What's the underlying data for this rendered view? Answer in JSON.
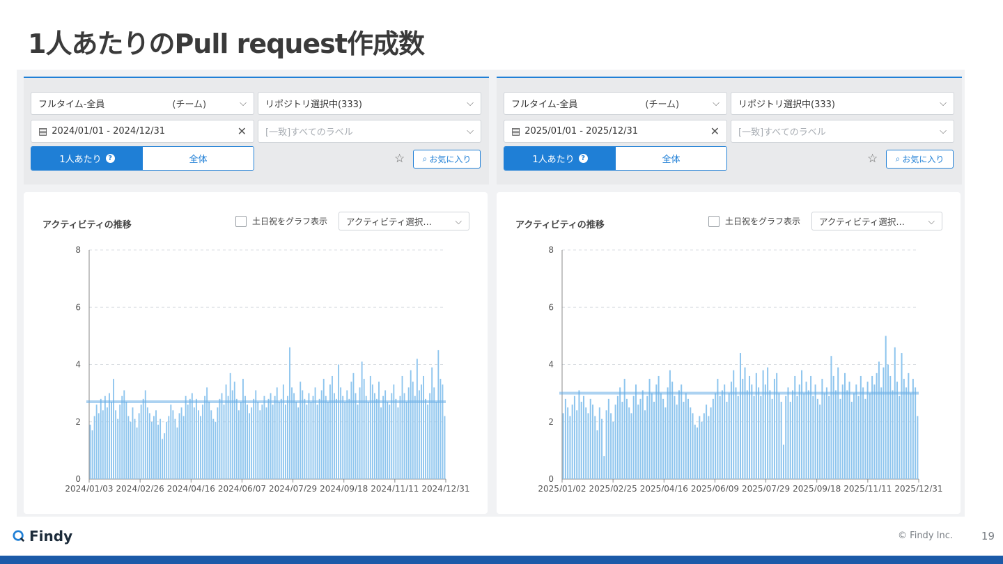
{
  "slide": {
    "title": "1人あたりのPull request作成数",
    "footer_brand": "Findy",
    "copyright": "© Findy Inc.",
    "page_number": "19"
  },
  "colors": {
    "accent": "#1f7fd6",
    "bar": "#8ec5ee",
    "avg_line": "#6aaee6",
    "footer_bar": "#1b5aa8"
  },
  "panels": [
    {
      "filters": {
        "member_select": "フルタイム-全員",
        "member_scope": "(チーム)",
        "repo_select": "リポジトリ選択中(333)",
        "date_range": "2024/01/01 - 2024/12/31",
        "label_placeholder": "[一致]すべてのラベル",
        "seg_per_person": "1人あたり",
        "seg_all": "全体",
        "favorite_label": "お気に入り"
      },
      "card": {
        "title": "アクティビティの推移",
        "weekend_checkbox": "土日祝をグラフ表示",
        "activity_select": "アクティビティ選択…"
      }
    },
    {
      "filters": {
        "member_select": "フルタイム-全員",
        "member_scope": "(チーム)",
        "repo_select": "リポジトリ選択中(333)",
        "date_range": "2025/01/01 - 2025/12/31",
        "label_placeholder": "[一致]すべてのラベル",
        "seg_per_person": "1人あたり",
        "seg_all": "全体",
        "favorite_label": "お気に入り"
      },
      "card": {
        "title": "アクティビティの推移",
        "weekend_checkbox": "土日祝をグラフ表示",
        "activity_select": "アクティビティ選択…"
      }
    }
  ],
  "chart_data": [
    {
      "type": "bar",
      "ylim": [
        0,
        8
      ],
      "yticks": [
        0,
        2,
        4,
        6,
        8
      ],
      "grid": "horizontal-dashed",
      "average": 2.7,
      "x_tick_labels": [
        "2024/01/03",
        "2024/02/26",
        "2024/04/16",
        "2024/06/07",
        "2024/07/29",
        "2024/09/18",
        "2024/11/11",
        "2024/12/31"
      ],
      "values": [
        1.9,
        1.7,
        2.2,
        2.6,
        2.3,
        2.8,
        2.4,
        2.9,
        2.5,
        3.0,
        2.7,
        3.5,
        2.4,
        2.1,
        2.6,
        2.9,
        3.1,
        2.7,
        2.2,
        2.0,
        2.5,
        2.1,
        1.8,
        2.3,
        2.6,
        2.8,
        3.1,
        2.5,
        2.3,
        2.0,
        2.2,
        2.4,
        1.9,
        2.1,
        1.4,
        1.6,
        2.0,
        2.2,
        2.6,
        2.4,
        2.1,
        1.8,
        2.3,
        2.5,
        2.2,
        2.9,
        2.6,
        2.8,
        3.0,
        2.5,
        2.8,
        2.4,
        2.2,
        2.6,
        2.9,
        3.2,
        2.7,
        2.4,
        2.1,
        2.0,
        2.5,
        2.8,
        3.0,
        2.6,
        3.3,
        2.9,
        3.7,
        3.1,
        3.4,
        2.8,
        2.4,
        2.7,
        3.5,
        2.9,
        2.6,
        2.3,
        2.5,
        2.8,
        3.1,
        2.7,
        2.4,
        2.6,
        2.9,
        2.5,
        2.8,
        3.0,
        2.6,
        2.9,
        3.2,
        2.7,
        2.8,
        3.3,
        2.6,
        2.9,
        4.6,
        3.2,
        3.0,
        2.7,
        2.5,
        3.4,
        3.1,
        2.8,
        2.6,
        3.0,
        2.7,
        2.9,
        3.2,
        2.6,
        2.8,
        3.1,
        3.5,
        2.9,
        2.7,
        3.3,
        3.6,
        3.0,
        2.8,
        4.0,
        3.2,
        2.9,
        2.7,
        3.1,
        2.8,
        3.4,
        3.7,
        3.0,
        2.6,
        3.2,
        4.1,
        3.5,
        2.9,
        2.7,
        3.6,
        3.3,
        3.0,
        2.8,
        3.4,
        2.5,
        2.9,
        3.1,
        2.7,
        2.6,
        3.0,
        3.3,
        2.8,
        2.5,
        2.9,
        3.6,
        3.0,
        2.7,
        3.2,
        3.8,
        3.4,
        2.9,
        4.2,
        3.1,
        3.3,
        3.6,
        2.8,
        2.6,
        3.0,
        3.9,
        3.2,
        2.7,
        4.5,
        3.5,
        3.3,
        2.2
      ]
    },
    {
      "type": "bar",
      "ylim": [
        0,
        8
      ],
      "yticks": [
        0,
        2,
        4,
        6,
        8
      ],
      "grid": "horizontal-dashed",
      "average": 3.0,
      "x_tick_labels": [
        "2025/01/02",
        "2025/02/25",
        "2025/04/16",
        "2025/06/09",
        "2025/07/29",
        "2025/09/18",
        "2025/11/11",
        "2025/12/31"
      ],
      "values": [
        2.3,
        2.8,
        2.5,
        2.2,
        2.6,
        2.9,
        2.4,
        3.1,
        2.7,
        2.9,
        2.5,
        2.3,
        2.8,
        2.6,
        2.2,
        1.7,
        2.5,
        2.1,
        0.8,
        2.4,
        2.8,
        2.3,
        2.0,
        2.6,
        2.9,
        3.2,
        2.7,
        3.5,
        2.8,
        2.5,
        2.3,
        2.9,
        3.3,
        2.6,
        2.8,
        3.1,
        2.4,
        2.9,
        3.5,
        3.0,
        2.7,
        3.3,
        3.6,
        3.0,
        2.8,
        2.5,
        3.2,
        3.8,
        3.4,
        2.9,
        2.6,
        3.1,
        3.3,
        2.7,
        3.0,
        2.8,
        2.5,
        2.3,
        1.9,
        1.8,
        2.2,
        2.0,
        2.3,
        2.6,
        2.2,
        2.5,
        2.8,
        3.0,
        3.5,
        2.9,
        3.1,
        3.3,
        2.7,
        3.0,
        3.4,
        3.8,
        3.2,
        2.9,
        4.4,
        3.5,
        3.9,
        3.1,
        3.6,
        3.3,
        2.9,
        3.7,
        3.2,
        2.9,
        3.8,
        3.3,
        3.9,
        3.1,
        2.8,
        3.5,
        3.7,
        3.0,
        2.7,
        1.2,
        2.9,
        3.2,
        2.7,
        3.1,
        3.6,
        2.9,
        3.3,
        3.8,
        3.0,
        3.4,
        3.1,
        3.6,
        2.9,
        3.3,
        2.8,
        2.6,
        3.5,
        3.0,
        3.2,
        2.9,
        4.3,
        3.6,
        3.1,
        3.9,
        2.8,
        3.3,
        3.7,
        3.1,
        3.4,
        2.7,
        3.0,
        3.3,
        2.9,
        3.6,
        3.2,
        2.8,
        3.4,
        3.0,
        3.6,
        3.3,
        3.7,
        4.1,
        3.2,
        3.9,
        5.0,
        4.0,
        3.6,
        3.1,
        4.6,
        3.4,
        2.9,
        4.4,
        3.5,
        3.2,
        3.7,
        3.0,
        3.5,
        3.2,
        2.2
      ]
    }
  ]
}
